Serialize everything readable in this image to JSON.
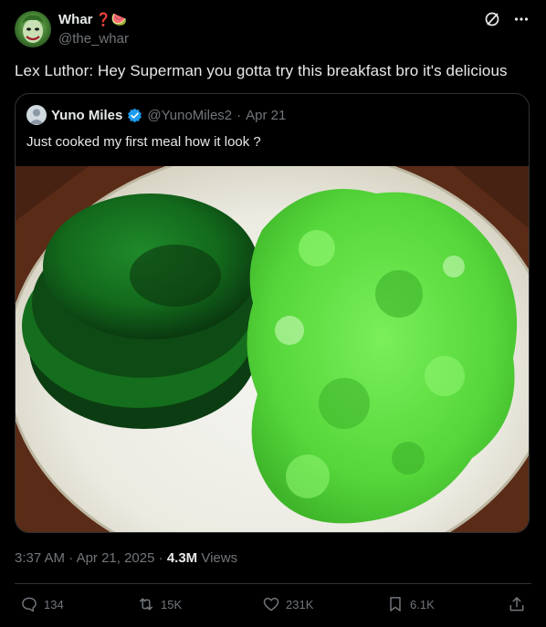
{
  "tweet": {
    "author_name": "Whar",
    "author_emojis": "❓🍉",
    "author_handle": "@the_whar",
    "text": "Lex Luthor: Hey Superman you gotta try this breakfast bro it's delicious",
    "avatar_icon": "joker-avatar"
  },
  "quote": {
    "author_name": "Yuno Miles",
    "verified": true,
    "author_handle": "@YunoMiles2",
    "separator": "·",
    "date": "Apr 21",
    "text": "Just cooked my first meal how it look ?",
    "media_icon": "green-breakfast-photo"
  },
  "meta": {
    "time": "3:37 AM",
    "separator": "·",
    "date": "Apr 21, 2025",
    "views_count": "4.3M",
    "views_label": "Views"
  },
  "actions": {
    "replies": "134",
    "reposts": "15K",
    "likes": "231K",
    "bookmarks": "6.1K"
  },
  "colors": {
    "background": "#000000",
    "text": "#e7e9ea",
    "muted": "#71767b",
    "border": "#2f3336",
    "verified": "#1d9bf0"
  }
}
